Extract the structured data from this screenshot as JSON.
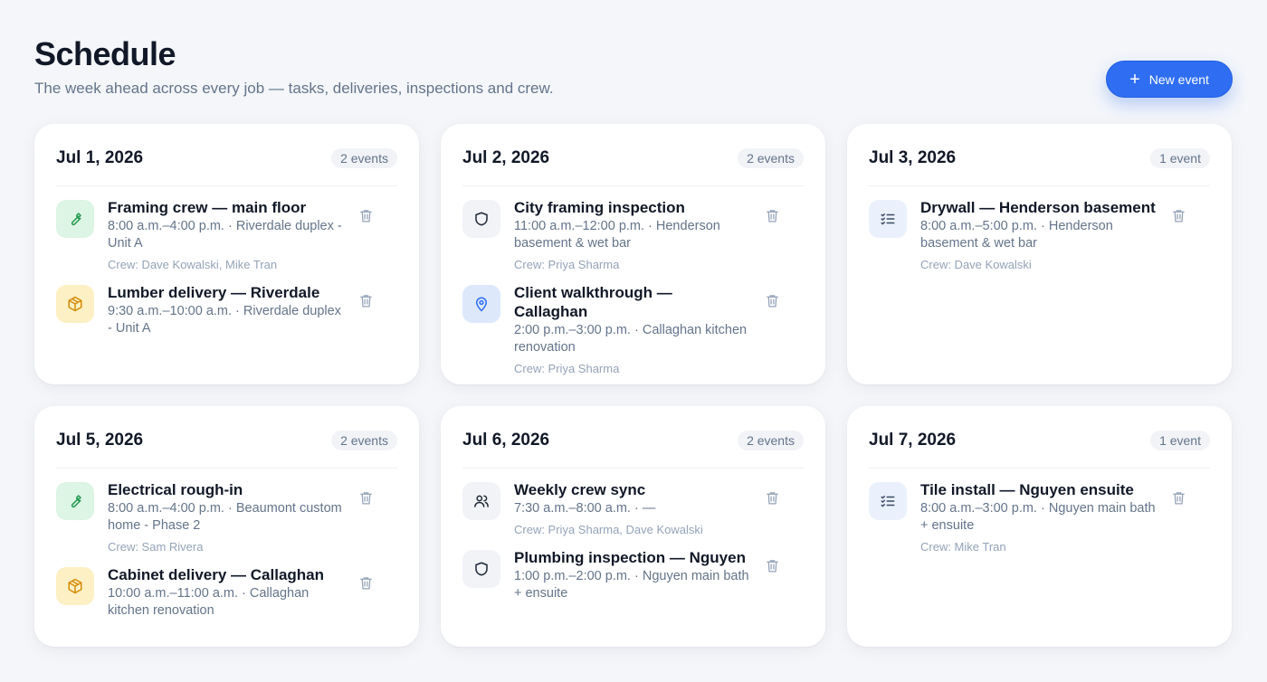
{
  "header": {
    "title": "Schedule",
    "subtitle": "The week ahead across every job — tasks, deliveries, inspections and crew.",
    "new_event_label": "New event"
  },
  "days": [
    {
      "date": "Jul 1, 2026",
      "count": "2 events",
      "events": [
        {
          "icon": "wrench-icon",
          "color": "green",
          "title": "Framing crew — main floor",
          "detail": "8:00 a.m.–4:00 p.m. · Riverdale duplex - Unit A",
          "crew": "Crew: Dave Kowalski, Mike Tran"
        },
        {
          "icon": "box-icon",
          "color": "yellow",
          "title": "Lumber delivery — Riverdale",
          "detail": "9:30 a.m.–10:00 a.m. · Riverdale duplex - Unit A",
          "crew": ""
        }
      ]
    },
    {
      "date": "Jul 2, 2026",
      "count": "2 events",
      "events": [
        {
          "icon": "shield-icon",
          "color": "gray",
          "title": "City framing inspection",
          "detail": "11:00 a.m.–12:00 p.m. · Henderson basement & wet bar",
          "crew": "Crew: Priya Sharma"
        },
        {
          "icon": "map-pin-icon",
          "color": "blue",
          "title": "Client walkthrough — Callaghan",
          "detail": "2:00 p.m.–3:00 p.m. · Callaghan kitchen renovation",
          "crew": "Crew: Priya Sharma"
        }
      ]
    },
    {
      "date": "Jul 3, 2026",
      "count": "1 event",
      "events": [
        {
          "icon": "checklist-icon",
          "color": "lightblue",
          "title": "Drywall — Henderson basement",
          "detail": "8:00 a.m.–5:00 p.m. · Henderson basement & wet bar",
          "crew": "Crew: Dave Kowalski"
        }
      ]
    },
    {
      "date": "Jul 5, 2026",
      "count": "2 events",
      "events": [
        {
          "icon": "wrench-icon",
          "color": "green",
          "title": "Electrical rough-in",
          "detail": "8:00 a.m.–4:00 p.m. · Beaumont custom home - Phase 2",
          "crew": "Crew: Sam Rivera"
        },
        {
          "icon": "box-icon",
          "color": "yellow",
          "title": "Cabinet delivery — Callaghan",
          "detail": "10:00 a.m.–11:00 a.m. · Callaghan kitchen renovation",
          "crew": ""
        }
      ]
    },
    {
      "date": "Jul 6, 2026",
      "count": "2 events",
      "events": [
        {
          "icon": "users-icon",
          "color": "gray",
          "title": "Weekly crew sync",
          "detail": "7:30 a.m.–8:00 a.m. · —",
          "crew": "Crew: Priya Sharma, Dave Kowalski"
        },
        {
          "icon": "shield-icon",
          "color": "gray",
          "title": "Plumbing inspection — Nguyen",
          "detail": "1:00 p.m.–2:00 p.m. · Nguyen main bath + ensuite",
          "crew": ""
        }
      ]
    },
    {
      "date": "Jul 7, 2026",
      "count": "1 event",
      "events": [
        {
          "icon": "checklist-icon",
          "color": "lightblue",
          "title": "Tile install — Nguyen ensuite",
          "detail": "8:00 a.m.–3:00 p.m. · Nguyen main bath + ensuite",
          "crew": "Crew: Mike Tran"
        }
      ]
    }
  ]
}
